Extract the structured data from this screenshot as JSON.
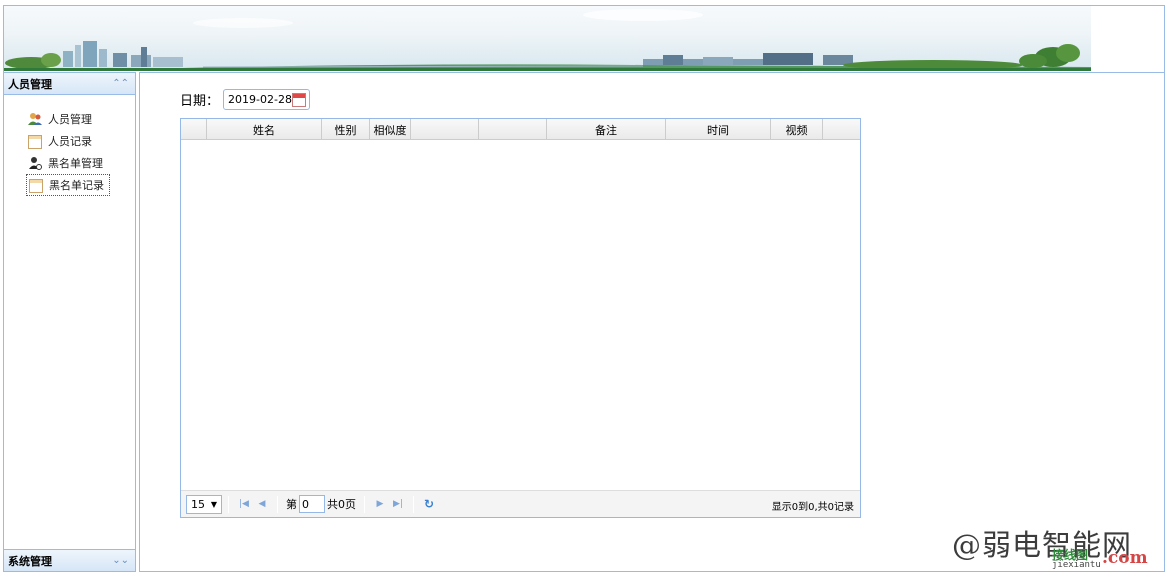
{
  "sidebar": {
    "panel_title": "人员管理",
    "items": [
      {
        "label": "人员管理",
        "icon": "people-icon"
      },
      {
        "label": "人员记录",
        "icon": "record-icon"
      },
      {
        "label": "黑名单管理",
        "icon": "blacklist-icon"
      },
      {
        "label": "黑名单记录",
        "icon": "record-icon",
        "active": true
      }
    ],
    "footer_title": "系统管理"
  },
  "filter": {
    "date_label": "日期：",
    "date_value": "2019-02-28"
  },
  "grid": {
    "columns": [
      "",
      "姓名",
      "性别",
      "相似度",
      "",
      "",
      "备注",
      "时间",
      "视频",
      ""
    ],
    "rows": []
  },
  "pager": {
    "page_size": "15",
    "page_prefix": "第",
    "page_value": "0",
    "page_total": "共0页",
    "info": "显示0到0,共0记录"
  },
  "watermark": {
    "main": "@弱电智能网",
    "sub1": "接线图",
    "com": ".com",
    "sub2": "jiexiantu"
  }
}
